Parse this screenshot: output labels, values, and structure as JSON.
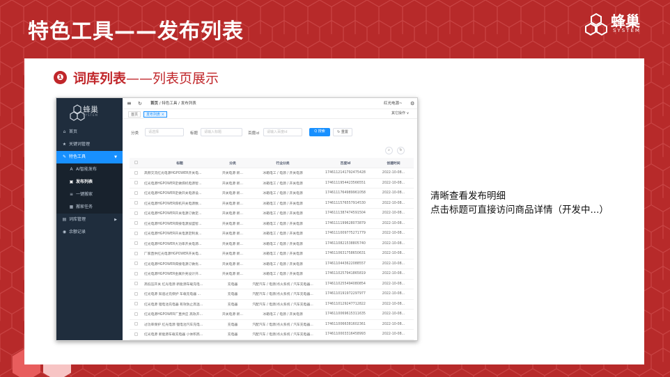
{
  "slide": {
    "title": "特色工具——发布列表",
    "logo_name": "蜂巢",
    "logo_sub": "SYSTEM",
    "section_num": "❶",
    "section_title_bold": "词库列表",
    "section_title_rest": "——列表页展示",
    "notes": [
      "清晰查看发布明细",
      "点击标题可直接访问商品详情（开发中...）"
    ]
  },
  "app": {
    "logo_name": "蜂巢",
    "logo_sub": "SYSTEM",
    "menu": [
      {
        "icon": "⌂",
        "label": "首页",
        "type": "top"
      },
      {
        "icon": "★",
        "label": "关键词管理",
        "type": "top"
      },
      {
        "icon": "✎",
        "label": "特色工具",
        "type": "active",
        "arrow": "▼"
      },
      {
        "icon": "A",
        "label": "AI智能发布",
        "type": "sub"
      },
      {
        "icon": "▣",
        "label": "发布列表",
        "type": "subactive"
      },
      {
        "icon": "≡",
        "label": "一键搬家",
        "type": "sub"
      },
      {
        "icon": "▦",
        "label": "搬家任务",
        "type": "sub"
      },
      {
        "icon": "▤",
        "label": "词库管理",
        "type": "top",
        "arrow": "▶"
      },
      {
        "icon": "◉",
        "label": "余额记录",
        "type": "top"
      }
    ],
    "topbar": {
      "menu_icon": "≡",
      "refresh_icon": "↻",
      "breadcrumb": [
        "首页",
        "/",
        "特色工具",
        "/",
        "发布列表"
      ],
      "user": "红光电源~",
      "settings_icon": "⚙"
    },
    "tabs": [
      {
        "label": "首页",
        "active": false
      },
      {
        "label": "发布列表 ×",
        "active": true
      }
    ],
    "other_ops": "其它操作 ∨",
    "filters": {
      "category_label": "分类",
      "category_placeholder": "请选择",
      "title_label": "标题",
      "title_placeholder": "请输入标题",
      "baiduid_label": "百度id",
      "baiduid_placeholder": "请输入百度id",
      "search_button": "Q 搜索",
      "reset_button": "↻ 重置"
    },
    "table": {
      "headers": [
        "",
        "标题",
        "分类",
        "行业分类",
        "百度id",
        "创建时间"
      ],
      "rows": [
        [
          "高频交流红光电源HGPOWER开关电...",
          "开关电源 新...",
          "冰箱电工 / 电源 / 开关电源",
          "1746112141792475428",
          "2022-10-08..."
        ],
        [
          "红光电源HGPOWER定做焊机电源智...",
          "开关电源 新...",
          "冰箱电工 / 电源 / 开关电源",
          "1746111954423566551",
          "2022-10-08..."
        ],
        [
          "红光电源HGPOWER定做开关电源设...",
          "开关电源 新...",
          "冰箱电工 / 电源 / 开关电源",
          "1746111764989961058",
          "2022-10-08..."
        ],
        [
          "红光电源HGPOWER焊机开关电源数...",
          "开关电源 新...",
          "冰箱电工 / 电源 / 开关电源",
          "1746111576557914530",
          "2022-10-08..."
        ],
        [
          "红光电源HGPOWER开关电源订做定...",
          "开关电源 新...",
          "冰箱电工 / 电源 / 开关电源",
          "1746111387474591504",
          "2022-10-08..."
        ],
        [
          "红光电源HGPOWER焊接电源加盟智...",
          "开关电源 新...",
          "冰箱电工 / 电源 / 开关电源",
          "1746111199628073879",
          "2022-10-08..."
        ],
        [
          "红光电源HGPOWER开关电源定制发...",
          "开关电源 新...",
          "冰箱电工 / 电源 / 开关电源",
          "1746111009775271779",
          "2022-10-08..."
        ],
        [
          "红光电源HGPOWER大功率开关电源...",
          "开关电源 新...",
          "冰箱电工 / 电源 / 开关电源",
          "1746110821538805740",
          "2022-10-08..."
        ],
        [
          "厂家直供红光电源HGPOWER开关电...",
          "开关电源 新...",
          "冰箱电工 / 电源 / 开关电源",
          "1746110631758650631",
          "2022-10-08..."
        ],
        [
          "红光电源HGPOWER焊接电源订做优...",
          "开关电源 新...",
          "冰箱电工 / 电源 / 开关电源",
          "1746110443622088557",
          "2022-10-08..."
        ],
        [
          "红光电源HGPOWER金属外壳设计开...",
          "开关电源 新...",
          "冰箱电工 / 电源 / 开关电源",
          "1746110257941865819",
          "2022-10-08..."
        ],
        [
          "高低压开关 红光电源 新能源车载充电...",
          "充电器",
          "汽配汽车 / 电源/点火系统 / 汽车充电器...",
          "1746110255494080854",
          "2022-10-08..."
        ],
        [
          "红光电源 知道过充保护 车载充电器 ...",
          "充电器",
          "汽配汽车 / 电源/点火系统 / 汽车充电器...",
          "1746110191972297977",
          "2022-10-08..."
        ],
        [
          "红光电源 锂电池充电器 有效防止高温...",
          "充电器",
          "汽配汽车 / 电源/点火系统 / 汽车充电器...",
          "1746110129247712822",
          "2022-10-08..."
        ],
        [
          "红光电源HGPOWER厂直供应 高效开...",
          "开关电源 新...",
          "冰箱电工 / 电源 / 开关电源",
          "1746110069615311635",
          "2022-10-08..."
        ],
        [
          "过功率保护 红光电源 锂电池汽车充电...",
          "充电器",
          "汽配汽车 / 电源/点火系统 / 汽车充电器...",
          "1746110066381602361",
          "2022-10-08..."
        ],
        [
          "红光电源 新能源车载充电器 小体积高...",
          "充电器",
          "汽配汽车 / 电源/点火系统 / 汽车充电器...",
          "1746110003316458993",
          "2022-10-08..."
        ]
      ]
    }
  },
  "colors": {
    "brand_red": "#b72a2a",
    "accent_blue": "#1890ff",
    "sidebar": "#1f2d3d"
  }
}
